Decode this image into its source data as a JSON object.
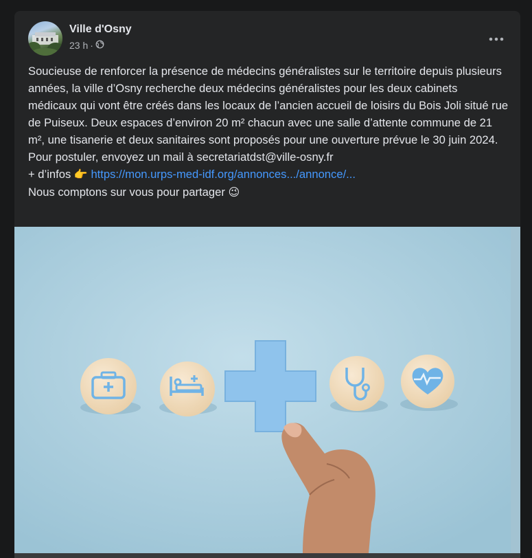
{
  "post": {
    "author": "Ville d'Osny",
    "time": "23 h",
    "separator": "·",
    "paragraph": "Soucieuse de renforcer la présence de médecins généralistes sur le territoire depuis plusieurs années, la ville d’Osny recherche deux médecins généralistes pour les deux cabinets médicaux qui vont être créés dans les locaux de l’ancien accueil de loisirs du Bois Joli situé rue de Puiseux. Deux espaces d’environ 20 m² chacun avec une salle d’attente commune de 21 m², une tisanerie et deux sanitaires sont proposés pour une ouverture prévue le 30 juin 2024.",
    "apply_line": "Pour postuler, envoyez un mail à secretariatdst@ville-osny.fr",
    "info_prefix": "+ d’infos",
    "info_emoji": "👉",
    "info_link": "https://mon.urps-med-idf.org/annonces.../annonce/...",
    "share_line": "Nous comptons sur vous pour partager",
    "share_emoji": "😉"
  },
  "colors": {
    "card_bg": "#242526",
    "page_bg": "#18191a",
    "text_primary": "#e4e6eb",
    "text_secondary": "#b0b3b8",
    "link": "#4599ff",
    "image_bg": "#aed0df",
    "cross": "#8fc3ec"
  },
  "icons": [
    "globe-icon",
    "more-options-icon",
    "medical-kit-icon",
    "hospital-bed-icon",
    "medical-cross-icon",
    "stethoscope-icon",
    "heartbeat-icon"
  ]
}
